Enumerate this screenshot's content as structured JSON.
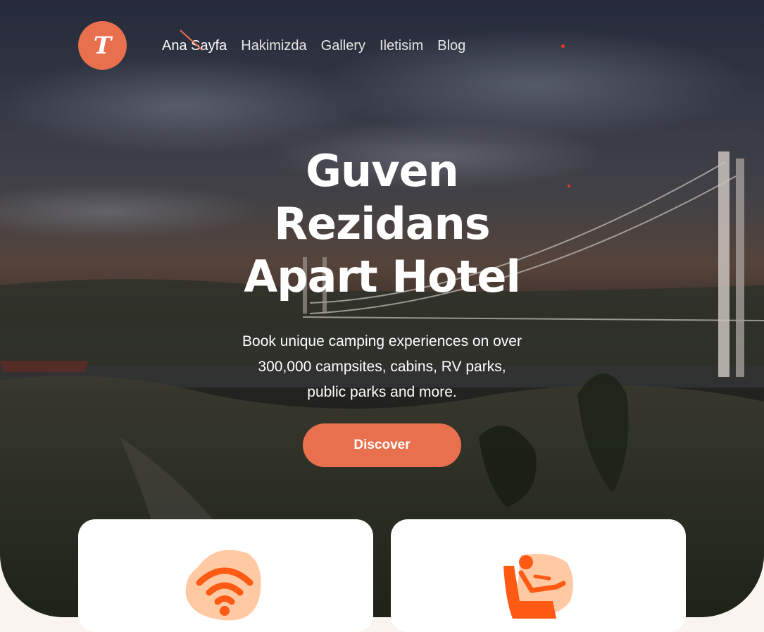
{
  "brand": {
    "logo_letter": "T",
    "accent": "#e8704e"
  },
  "nav": {
    "items": [
      {
        "label": "Ana Sayfa",
        "active": true
      },
      {
        "label": "Hakimizda"
      },
      {
        "label": "Gallery"
      },
      {
        "label": "Iletisim"
      },
      {
        "label": "Blog"
      }
    ]
  },
  "hero": {
    "title_lines": [
      "Guven",
      "Rezidans",
      "Apart Hotel"
    ],
    "subtitle_lines": [
      "Book unique camping experiences on over",
      "300,000 campsites, cabins, RV parks,",
      "public parks and more."
    ],
    "cta_label": "Discover"
  },
  "features": [
    {
      "icon": "wifi-icon"
    },
    {
      "icon": "armchair-person-icon"
    }
  ]
}
